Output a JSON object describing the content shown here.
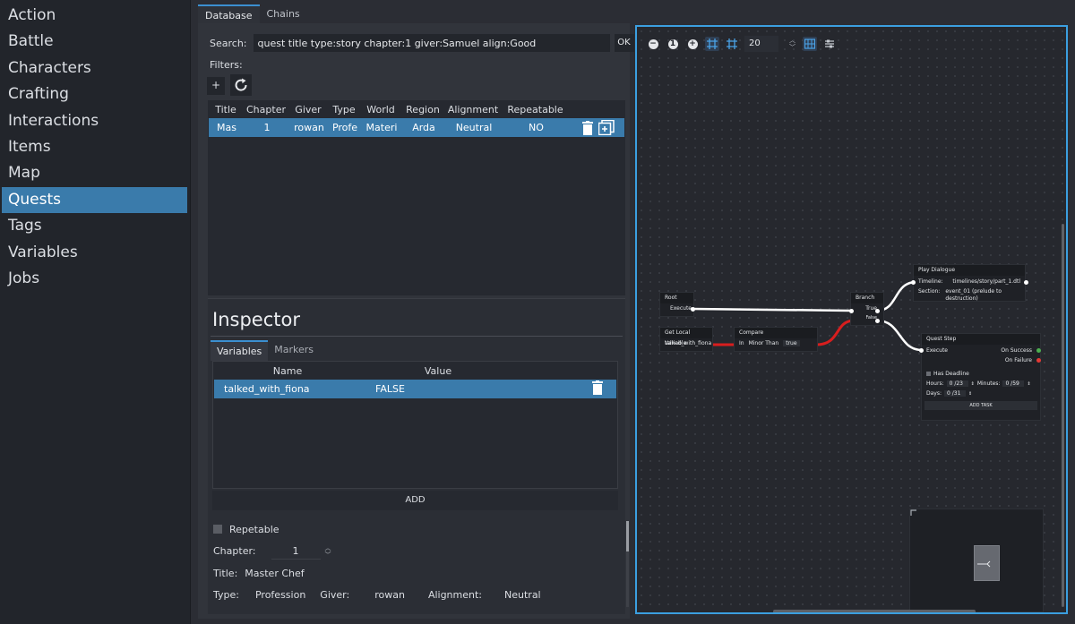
{
  "sidebar": {
    "items": [
      {
        "label": "Action"
      },
      {
        "label": "Battle"
      },
      {
        "label": "Characters"
      },
      {
        "label": "Crafting"
      },
      {
        "label": "Interactions"
      },
      {
        "label": "Items"
      },
      {
        "label": "Map"
      },
      {
        "label": "Quests",
        "active": true
      },
      {
        "label": "Tags"
      },
      {
        "label": "Variables"
      },
      {
        "label": "Jobs"
      }
    ]
  },
  "tabs": [
    {
      "label": "Database",
      "active": true
    },
    {
      "label": "Chains"
    }
  ],
  "search": {
    "label": "Search:",
    "value": "quest title type:story chapter:1 giver:Samuel align:Good",
    "ok_label": "OK"
  },
  "filters": {
    "label": "Filters:",
    "add_label": "+"
  },
  "quest_table": {
    "headers": [
      "Title",
      "Chapter",
      "Giver",
      "Type",
      "World",
      "Region",
      "Alignment",
      "Repeatable"
    ],
    "rows": [
      {
        "title": "Mas",
        "chapter": "1",
        "giver": "rowan",
        "type": "Profe",
        "world": "Materi",
        "region": "Arda",
        "alignment": "Neutral",
        "repeatable": "NO"
      }
    ]
  },
  "inspector": {
    "title": "Inspector",
    "tabs": [
      {
        "label": "Variables",
        "active": true
      },
      {
        "label": "Markers"
      }
    ],
    "variables": {
      "headers": [
        "Name",
        "Value"
      ],
      "rows": [
        {
          "name": "talked_with_fiona",
          "value": "FALSE"
        }
      ],
      "add_label": "ADD"
    },
    "props": {
      "repetable_label": "Repetable",
      "chapter_label": "Chapter:",
      "chapter_value": "1",
      "title_label": "Title:",
      "title_value": "Master Chef",
      "type_label": "Type:",
      "type_value": "Profession",
      "giver_label": "Giver:",
      "giver_value": "rowan",
      "alignment_label": "Alignment:",
      "alignment_value": "Neutral"
    }
  },
  "graph": {
    "toolbar": {
      "zoom_out": "−",
      "zoom_reset": "1",
      "zoom_in": "+",
      "snap_value": "20"
    },
    "nodes": {
      "root": {
        "title": "Root",
        "port": "Execute"
      },
      "get_var": {
        "title": "Get Local Variable",
        "value": "talked_with_fiona"
      },
      "compare": {
        "title": "Compare",
        "in": "In",
        "op": "Minor Than",
        "value": "true"
      },
      "branch": {
        "title": "Branch",
        "true": "True",
        "false": "False"
      },
      "play_dialogue": {
        "title": "Play Dialogue",
        "timeline_label": "Timeline:",
        "timeline_value": "timelines/story/part_1.dtl",
        "section_label": "Section:",
        "section_value": "event_01 (prelude to destruction)"
      },
      "quest_step": {
        "title": "Quest Step",
        "execute": "Execute",
        "on_success": "On Success",
        "on_failure": "On Failure",
        "deadline": "Has Deadline",
        "hours_label": "Hours:",
        "hours_value": "0 /23",
        "minutes_label": "Minutes:",
        "minutes_value": "0 /59",
        "days_label": "Days:",
        "days_value": "0 /31",
        "add_task": "ADD TASK"
      }
    },
    "colors": {
      "accent": "#3b9fe0",
      "selected": "#3a7bab",
      "wire_bool": "#d81e1e",
      "success": "#4caf50",
      "failure": "#e53935"
    }
  }
}
